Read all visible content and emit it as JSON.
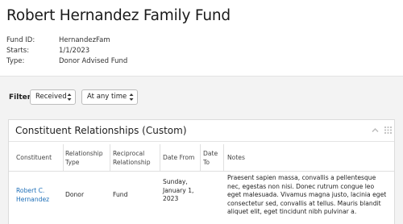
{
  "fund": {
    "title": "Robert Hernandez Family Fund",
    "fields": [
      {
        "label": "Fund ID:",
        "value": "HernandezFam"
      },
      {
        "label": "Starts:",
        "value": "1/1/2023"
      },
      {
        "label": "Type:",
        "value": "Donor Advised Fund"
      }
    ]
  },
  "filter": {
    "label": "Filter:",
    "status_value": "Received",
    "time_value": "At any time"
  },
  "panel": {
    "title": "Constituent Relationships (Custom)",
    "columns": [
      "Constituent",
      "Relationship Type",
      "Reciprocal Relationship",
      "Date From",
      "Date To",
      "Notes"
    ],
    "rows": [
      {
        "constituent": "Robert C. Hernandez",
        "relationship_type": "Donor",
        "reciprocal": "Fund",
        "date_from": "Sunday, January 1, 2023",
        "date_to": "",
        "notes": "Praesent sapien massa, convallis a pellentesque nec, egestas non nisi. Donec rutrum congue leo eget malesuada. Vivamus magna justo, lacinia eget consectetur sed, convallis at tellus. Mauris blandit aliquet elit, eget tincidunt nibh pulvinar a."
      }
    ]
  },
  "icons": {
    "collapse": "chevron-up-icon",
    "grid": "grid-icon",
    "select_arrows": "up-down-arrows-icon"
  }
}
